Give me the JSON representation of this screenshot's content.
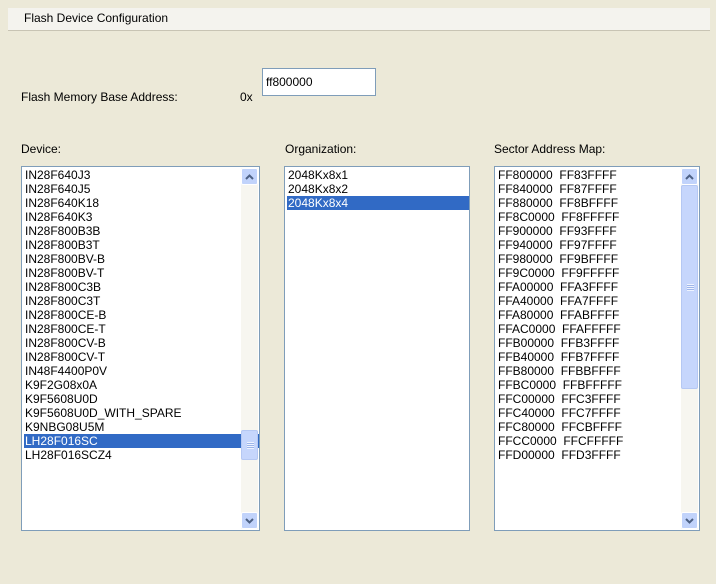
{
  "tab": {
    "label": "Flash Device Configuration"
  },
  "base_address": {
    "label": "Flash Memory Base Address:",
    "prefix": "0x",
    "value": "ff800000"
  },
  "device": {
    "label": "Device:",
    "items": [
      "IN28F640J3",
      "IN28F640J5",
      "IN28F640K18",
      "IN28F640K3",
      "IN28F800B3B",
      "IN28F800B3T",
      "IN28F800BV-B",
      "IN28F800BV-T",
      "IN28F800C3B",
      "IN28F800C3T",
      "IN28F800CE-B",
      "IN28F800CE-T",
      "IN28F800CV-B",
      "IN28F800CV-T",
      "IN48F4400P0V",
      "K9F2G08x0A",
      "K9F5608U0D",
      "K9F5608U0D_WITH_SPARE",
      "K9NBG08U5M",
      "LH28F016SC",
      "LH28F016SCZ4"
    ],
    "selected": "LH28F016SC",
    "scroll_fraction": 0.82
  },
  "organization": {
    "label": "Organization:",
    "items": [
      "2048Kx8x1",
      "2048Kx8x2",
      "2048Kx8x4"
    ],
    "selected": "2048Kx8x4"
  },
  "sector_map": {
    "label": "Sector Address Map:",
    "items": [
      "FF800000  FF83FFFF",
      "FF840000  FF87FFFF",
      "FF880000  FF8BFFFF",
      "FF8C0000  FF8FFFFF",
      "FF900000  FF93FFFF",
      "FF940000  FF97FFFF",
      "FF980000  FF9BFFFF",
      "FF9C0000  FF9FFFFF",
      "FFA00000  FFA3FFFF",
      "FFA40000  FFA7FFFF",
      "FFA80000  FFABFFFF",
      "FFAC0000  FFAFFFFF",
      "FFB00000  FFB3FFFF",
      "FFB40000  FFB7FFFF",
      "FFB80000  FFBBFFFF",
      "FFBC0000  FFBFFFFF",
      "FFC00000  FFC3FFFF",
      "FFC40000  FFC7FFFF",
      "FFC80000  FFCBFFFF",
      "FFCC0000  FFCFFFFF",
      "FFD00000  FFD3FFFF"
    ],
    "scroll_fraction": 0.0
  },
  "icons": {
    "scroll_up": "chevron-up-icon",
    "scroll_down": "chevron-down-icon"
  },
  "colors": {
    "selection": "#316ac5",
    "background": "#ece9d8"
  }
}
